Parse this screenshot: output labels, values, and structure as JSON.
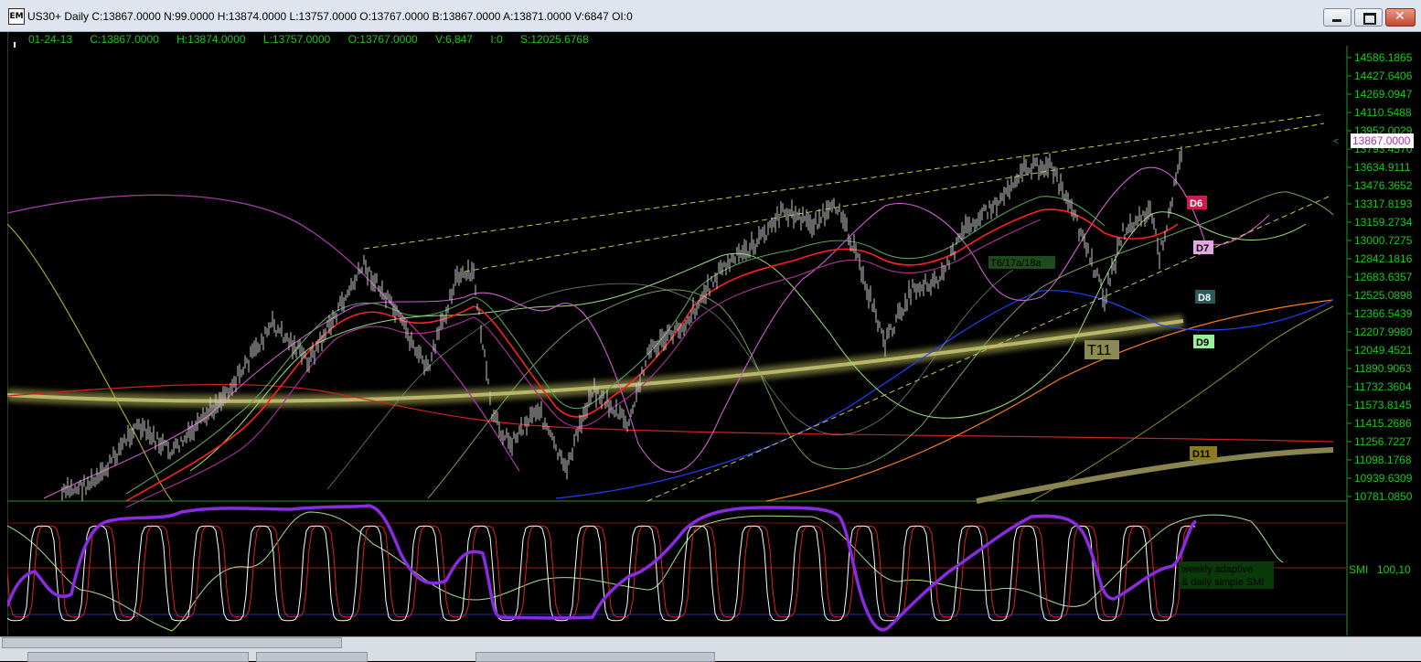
{
  "window": {
    "title": "US30+ Daily C:13867.0000 N:99.0000 H:13874.0000 L:13757.0000 O:13767.0000 B:13867.0000 A:13871.0000 V:6847 OI:0",
    "icon_label": "EM"
  },
  "info_line": {
    "date": "01-24-13",
    "close": "C:13867.0000",
    "high": "H:13874.0000",
    "low": "L:13757.0000",
    "open": "O:13767.0000",
    "volume": "V:6,847",
    "oi": "I:0",
    "s": "S:12025.6768"
  },
  "price_axis": {
    "labels": [
      "14586.1865",
      "14427.6406",
      "14269.0947",
      "14110.5488",
      "13952.0029",
      "13793.4570",
      "13634.9111",
      "13476.3652",
      "13317.8193",
      "13159.2734",
      "13000.7275",
      "12842.1816",
      "12683.6357",
      "12525.0898",
      "12366.5439",
      "12207.9980",
      "12049.4521",
      "11890.9063",
      "11732.3604",
      "11573.8145",
      "11415.2686",
      "11256.7227",
      "11098.1768",
      "10939.6309",
      "10781.0850"
    ],
    "current_price": "13867.0000"
  },
  "annotations": {
    "d6": "D6",
    "d7": "D7",
    "d8": "D8",
    "d9": "D9",
    "d11": "D11",
    "t11": "T11",
    "t6": "T6/17a/18a"
  },
  "indicator": {
    "label": "SMI",
    "value": "100,10",
    "note_line1": "weekly adaptive",
    "note_line2": "& daily simple SMI"
  },
  "colors": {
    "price_bars": "#c8c8c8",
    "up_text": "#19c919",
    "ma_red": "#ff2020",
    "ma_magenta": "#cc33cc",
    "ma_blue": "#1e3cff",
    "ma_orange": "#ff7a1a",
    "trend_yellow": "#c8c84a",
    "smi_purple": "#8a2be2"
  }
}
